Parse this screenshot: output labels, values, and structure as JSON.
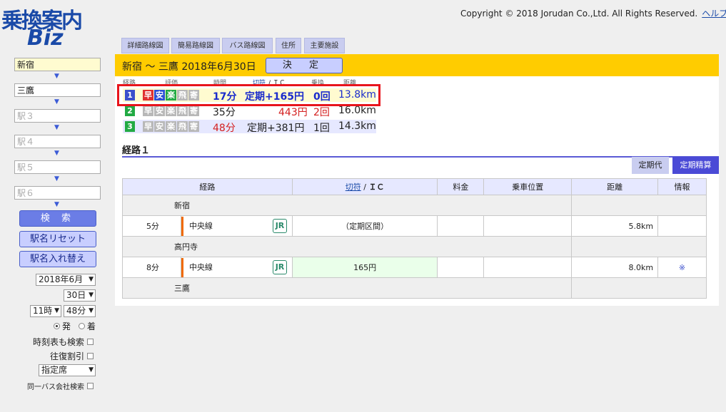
{
  "logo": {
    "line1": "乗換案内",
    "line2": "Biz"
  },
  "header": {
    "copyright": "Copyright © 2018 Jorudan Co.,Ltd. All Rights Reserved.",
    "help": "ヘルプ"
  },
  "tabs": [
    "詳細路線図",
    "簡易路線図",
    "バス路線図",
    "住所",
    "主要施設"
  ],
  "sidebar": {
    "from_value": "新宿",
    "to_value": "三鷹",
    "via_placeholders": [
      "駅３",
      "駅４",
      "駅５",
      "駅６"
    ],
    "search_label": "検 索",
    "reset_label": "駅名リセット",
    "swap_label": "駅名入れ替え",
    "month": "2018年6月",
    "day": "30日",
    "hour": "11時",
    "minute": "48分",
    "depart": "発",
    "arrive": "着",
    "timetable_check": "時刻表も検索",
    "roundtrip_check": "往復割引",
    "seat": "指定席",
    "samebus_check": "同一バス会社検索",
    "arrow": "▼"
  },
  "route": {
    "title": "新宿 〜 三鷹 2018年6月30日",
    "decide_label": "決 定",
    "col_headers": {
      "route": "経路",
      "rating": "評価",
      "time": "時間",
      "ticket": "切符",
      "ic": "/ ＩＣ",
      "transfers": "乗換",
      "distance": "距離"
    },
    "rows": [
      {
        "num": "1",
        "badges": [
          "早",
          "安",
          "楽",
          "飛",
          "寄"
        ],
        "time": "17分",
        "fare": "定期+165円",
        "transfers": "0回",
        "distance": "13.8km"
      },
      {
        "num": "2",
        "badges": [
          "早",
          "安",
          "楽",
          "飛",
          "寄"
        ],
        "time": "35分",
        "fare": "443円",
        "transfers": "2回",
        "distance": "16.0km"
      },
      {
        "num": "3",
        "badges": [
          "早",
          "安",
          "楽",
          "飛",
          "寄"
        ],
        "time": "48分",
        "fare": "定期+381円",
        "transfers": "1回",
        "distance": "14.3km"
      }
    ]
  },
  "detail": {
    "section_title": "経路１",
    "toggle_pass": "定期代",
    "toggle_settle": "定期精算",
    "headers": {
      "route": "経路",
      "ticket": "切符",
      "ic": "ＩＣ",
      "fee": "料金",
      "position": "乗車位置",
      "distance": "距離",
      "info": "情報",
      "sep": " / "
    },
    "stations": [
      "新宿",
      "高円寺",
      "三鷹"
    ],
    "segments": [
      {
        "duration": "5分",
        "line": "中央線",
        "operator": "JR",
        "fare": "（定期区間）",
        "distance": "5.8km",
        "info": ""
      },
      {
        "duration": "8分",
        "line": "中央線",
        "operator": "JR",
        "fare": "165円",
        "distance": "8.0km",
        "info": "※"
      }
    ]
  },
  "colors": {
    "accent_yellow": "#ffcc00",
    "highlight": "#e8141c",
    "tab_bg": "#c9cdf0",
    "fast": "#e03030",
    "cheap": "#2b4fd6",
    "easy": "#22aa44",
    "muted": "#b8b8b8"
  }
}
